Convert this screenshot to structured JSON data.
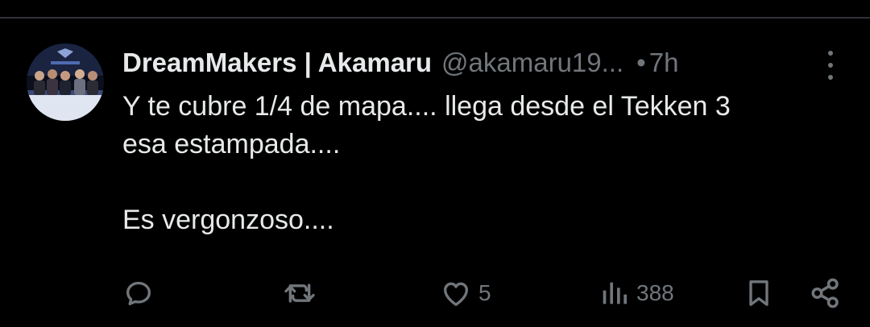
{
  "tweet": {
    "author": {
      "display_name": "DreamMakers | Akamaru",
      "handle": "@akamaru19...",
      "avatar_icon": "group-photo-avatar"
    },
    "separator": "•",
    "time": "7h",
    "text_lines": [
      "Y te cubre 1/4 de mapa.... llega desde el Tekken 3",
      "esa estampada....",
      "",
      "Es vergonzoso...."
    ],
    "actions": {
      "reply": {
        "icon": "reply-icon",
        "count": ""
      },
      "retweet": {
        "icon": "retweet-icon",
        "count": ""
      },
      "like": {
        "icon": "heart-icon",
        "count": "5"
      },
      "views": {
        "icon": "views-bar-chart-icon",
        "count": "388"
      },
      "bookmark": {
        "icon": "bookmark-icon"
      },
      "share": {
        "icon": "share-icon"
      }
    }
  },
  "colors": {
    "background": "#000000",
    "text_primary": "#e7e9ea",
    "text_secondary": "#71767b",
    "divider": "#2f3336"
  }
}
